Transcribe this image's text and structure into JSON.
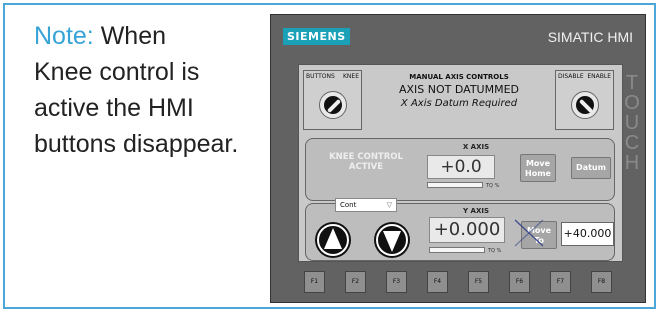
{
  "note": {
    "lead": "Note:",
    "line1_rest": " When",
    "line2": "Knee control is",
    "line3": "active the HMI",
    "line4": "buttons disappear."
  },
  "hmi": {
    "brand": "SIEMENS",
    "model": "SIMATIC HMI",
    "side_text": "TOUCH"
  },
  "screen": {
    "left_switch": {
      "label_left": "BUTTONS",
      "label_right": "KNEE"
    },
    "right_switch": {
      "label_left": "DISABLE",
      "label_right": "ENABLE"
    },
    "manual": {
      "title": "MANUAL AXIS CONTROLS",
      "status": "AXIS NOT DATUMMED",
      "datum_note": "X Axis Datum Required"
    },
    "x_axis": {
      "title": "X AXIS",
      "knee_text": "KNEE CONTROL ACTIVE",
      "readout": "+0.0",
      "tq_label": "TQ %",
      "move_home": "Move Home",
      "datum": "Datum"
    },
    "y_axis": {
      "title": "Y AXIS",
      "readout": "+0.000",
      "tq_label": "TQ %",
      "move_to": "Move To",
      "setpoint": "+40.000",
      "mode": "Cont"
    }
  },
  "fkeys": [
    "F1",
    "F2",
    "F3",
    "F4",
    "F5",
    "F6",
    "F7",
    "F8"
  ],
  "colors": {
    "accent": "#37a3d6",
    "bezel": "#626262",
    "screen": "#c9c9c9"
  }
}
